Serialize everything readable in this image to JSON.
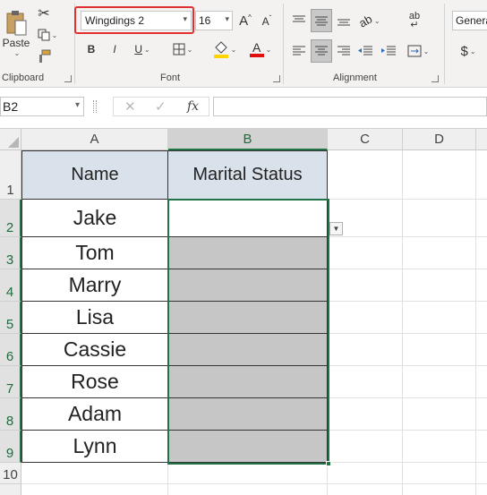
{
  "ribbon": {
    "clipboard": {
      "paste_label": "Paste",
      "group_label": "Clipboard"
    },
    "font": {
      "font_name": "Wingdings 2",
      "font_size": "16",
      "group_label": "Font",
      "bold": "B",
      "italic": "I",
      "underline": "U",
      "grow": "A",
      "shrink": "A",
      "font_color": "A"
    },
    "alignment": {
      "group_label": "Alignment"
    },
    "number": {
      "format_value": "Genera",
      "currency": "$"
    }
  },
  "formula_bar": {
    "name_box": "B2",
    "fx": "fx",
    "formula": ""
  },
  "sheet": {
    "columns": [
      "A",
      "B",
      "C",
      "D"
    ],
    "rows": [
      "1",
      "2",
      "3",
      "4",
      "5",
      "6",
      "7",
      "8",
      "9",
      "10"
    ],
    "headers": {
      "name": "Name",
      "status": "Marital Status"
    },
    "names": [
      "Jake",
      "Tom",
      "Marry",
      "Lisa",
      "Cassie",
      "Rose",
      "Adam",
      "Lynn"
    ]
  },
  "colors": {
    "accent": "#217346",
    "highlight_box": "#e03030",
    "header_fill": "#d9e1ea",
    "gray_fill": "#c6c6c6"
  }
}
